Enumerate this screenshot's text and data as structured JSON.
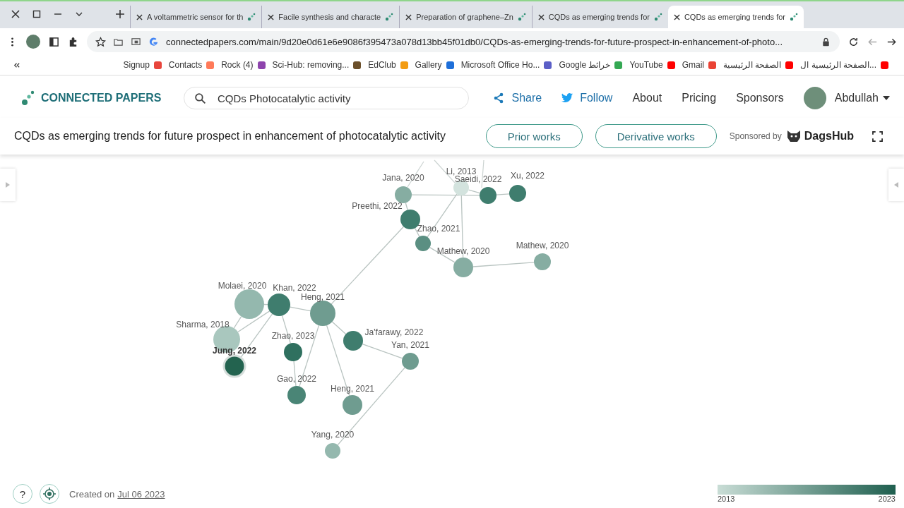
{
  "browser": {
    "tabs": [
      {
        "title": "A voltammetric sensor for th",
        "selected": false
      },
      {
        "title": "Facile synthesis and characte",
        "selected": false
      },
      {
        "title": "Preparation of graphene–Zn",
        "selected": false
      },
      {
        "title": "CQDs as emerging trends for",
        "selected": false
      },
      {
        "title": "CQDs as emerging trends for",
        "selected": true
      }
    ],
    "url": "connectedpapers.com/main/9d20e0d61e6e9086f395473a078d13bb45f01db0/CQDs-as-emerging-trends-for-future-prospect-in-enhancement-of-photo...",
    "bookmarks": [
      {
        "label": "Signup",
        "color": "#e8453c"
      },
      {
        "label": "Contacts",
        "color": "#ff7a59"
      },
      {
        "label": "Rock (4)",
        "color": "#8e44ad"
      },
      {
        "label": "Sci-Hub: removing...",
        "color": "#6b4f2a"
      },
      {
        "label": "EdClub",
        "color": "#f39c12"
      },
      {
        "label": "Gallery",
        "color": "#1e6fd9"
      },
      {
        "label": "Microsoft Office Ho...",
        "color": "#5b5fc7"
      },
      {
        "label": "Google خرائط",
        "color": "#34a853"
      },
      {
        "label": "YouTube",
        "color": "#ff0000"
      },
      {
        "label": "Gmail",
        "color": "#ea4335"
      },
      {
        "label": "الصفحة الرئيسية",
        "color": "#ff0000"
      },
      {
        "label": "الصفحة الرئيسية ال...",
        "color": "#ff0000"
      }
    ]
  },
  "header": {
    "logo": "CONNECTED PAPERS",
    "search": "CQDs Photocatalytic activity",
    "nav": [
      {
        "label": "Share",
        "kind": "share"
      },
      {
        "label": "Follow",
        "kind": "follow"
      },
      {
        "label": "About",
        "kind": "plain"
      },
      {
        "label": "Pricing",
        "kind": "plain"
      },
      {
        "label": "Sponsors",
        "kind": "plain"
      }
    ],
    "user": "Abdullah"
  },
  "subheader": {
    "title": "CQDs as emerging trends for future prospect in enhancement of photocatalytic activity",
    "buttons": [
      "Prior works",
      "Derivative works"
    ],
    "sponsored_by": "Sponsored by",
    "sponsor": "DagsHub"
  },
  "graph": {
    "nodes": [
      {
        "label": "Jana, 2020",
        "color": "#86ada2",
        "selected": false
      },
      {
        "label": "Li, 2013",
        "color": "#d3e3de",
        "selected": false
      },
      {
        "label": "Saeidi, 2022",
        "color": "#3f7d6e",
        "selected": false
      },
      {
        "label": "Xu, 2022",
        "color": "#3f7d6e",
        "selected": false
      },
      {
        "label": "Preethi, 2022",
        "color": "#3f7d6e",
        "selected": false
      },
      {
        "label": "Zhao, 2021",
        "color": "#5b8f82",
        "selected": false
      },
      {
        "label": "Mathew, 2020",
        "color": "#86ada2",
        "selected": false
      },
      {
        "label": "Mathew, 2020",
        "color": "#86ada2",
        "selected": false
      },
      {
        "label": "Molaei, 2020",
        "color": "#94b8ae",
        "selected": false
      },
      {
        "label": "Khan, 2022",
        "color": "#3f7d6e",
        "selected": false
      },
      {
        "label": "Heng, 2021",
        "color": "#6f9c90",
        "selected": false
      },
      {
        "label": "Sharma, 2018",
        "color": "#a9c7be",
        "selected": false
      },
      {
        "label": "Zhao, 2023",
        "color": "#2f705f",
        "selected": false
      },
      {
        "label": "Ja'farawy, 2022",
        "color": "#3f7d6e",
        "selected": false
      },
      {
        "label": "Jung, 2022",
        "color": "#23634f",
        "selected": true
      },
      {
        "label": "Yan, 2021",
        "color": "#6f9c90",
        "selected": false
      },
      {
        "label": "Gao, 2022",
        "color": "#4a8576",
        "selected": false
      },
      {
        "label": "Heng, 2021",
        "color": "#6f9c90",
        "selected": false
      },
      {
        "label": "Yang, 2020",
        "color": "#94b8ae",
        "selected": false
      }
    ]
  },
  "footer": {
    "help": "?",
    "created_label": "Created on",
    "created_date": "Jul 06 2023",
    "legend": {
      "start": "2013",
      "end": "2023"
    }
  }
}
